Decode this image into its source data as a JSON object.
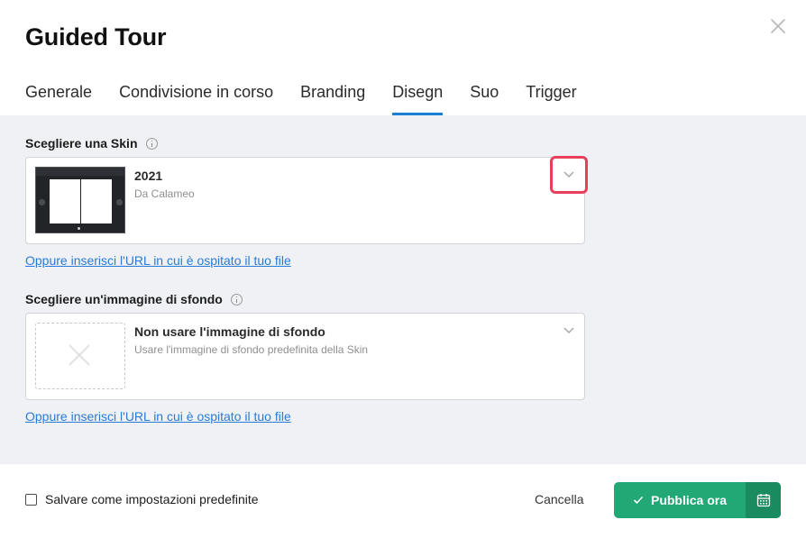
{
  "dialog": {
    "title": "Guided Tour",
    "close_icon": "close-icon"
  },
  "tabs": [
    {
      "label": "Generale",
      "active": false
    },
    {
      "label": "Condivisione in corso",
      "active": false
    },
    {
      "label": "Branding",
      "active": false
    },
    {
      "label": "Disegn",
      "active": true
    },
    {
      "label": "Suo",
      "active": false
    },
    {
      "label": "Trigger",
      "active": false
    }
  ],
  "skin": {
    "label": "Scegliere una Skin",
    "info_icon": "info-icon",
    "selected_title": "2021",
    "selected_subtitle": "Da Calameo",
    "url_link": "Oppure inserisci l'URL in cui è ospitato il tuo file",
    "highlight_color": "#e8405a"
  },
  "background": {
    "label": "Scegliere un'immagine di sfondo",
    "info_icon": "info-icon",
    "selected_title": "Non usare l'immagine di sfondo",
    "selected_subtitle": "Usare l'immagine di sfondo predefinita della Skin",
    "url_link": "Oppure inserisci l'URL in cui è ospitato il tuo file"
  },
  "footer": {
    "checkbox_label": "Salvare come impostazioni predefinite",
    "checkbox_checked": false,
    "cancel_label": "Cancella",
    "publish_label": "Pubblica ora",
    "publish_color": "#21a875",
    "schedule_icon": "calendar-icon"
  },
  "colors": {
    "accent": "#1c7ed6",
    "link": "#2a7bd6",
    "panel_bg": "#f0f1f4"
  }
}
